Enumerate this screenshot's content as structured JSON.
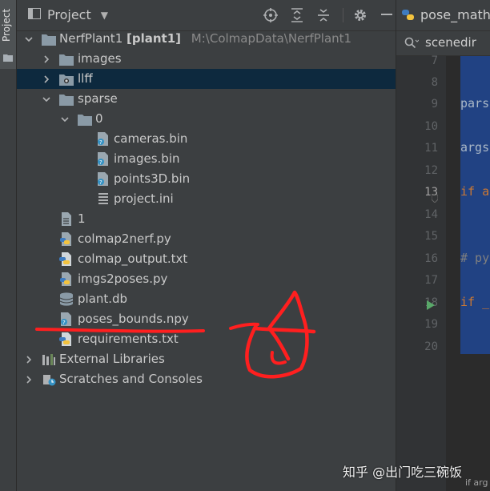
{
  "tool_strip": {
    "project_label": "Project"
  },
  "panel_header": {
    "title": "Project",
    "icons": [
      "locate-icon",
      "expand-all-icon",
      "collapse-all-icon",
      "gear-icon"
    ]
  },
  "tree": {
    "root": {
      "name": "NerfPlant1",
      "module": "[plant1]",
      "path": "M:\\ColmapData\\NerfPlant1"
    },
    "images": "images",
    "llff": "llff",
    "sparse": "sparse",
    "sparse_0": "0",
    "cameras": "cameras.bin",
    "images_bin": "images.bin",
    "points3d": "points3D.bin",
    "project_ini": "project.ini",
    "file_1": "1",
    "colmap2nerf": "colmap2nerf.py",
    "colmap_output": "colmap_output.txt",
    "imgs2poses": "imgs2poses.py",
    "plant_db": "plant.db",
    "poses_bounds": "poses_bounds.npy",
    "requirements": "requirements.txt",
    "external_libraries": "External Libraries",
    "scratches": "Scratches and Consoles"
  },
  "editor": {
    "tab_label": "pose_math.p",
    "search_text": "scenedir",
    "line_numbers": [
      "7",
      "8",
      "9",
      "10",
      "11",
      "12",
      "13",
      "14",
      "15",
      "16",
      "17",
      "18",
      "19",
      "20"
    ],
    "current_line": "13",
    "code_snippets": {
      "line9": "pars",
      "line11": "args",
      "line13": "if a",
      "line16": "# py",
      "line18": "if _"
    },
    "bottom_hint": "if arg"
  },
  "watermark": "知乎 @出门吃三碗饭",
  "colors": {
    "panel_bg": "#3c3f41",
    "selected_row": "#0d293e",
    "editor_bg": "#2b2b2b",
    "code_highlight": "#214283",
    "annotation_red": "#ff1f1f",
    "run_arrow": "#59a869"
  }
}
